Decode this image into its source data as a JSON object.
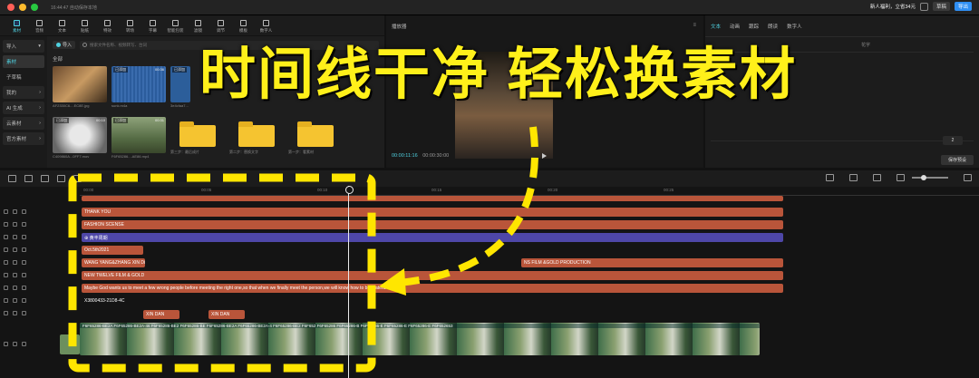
{
  "titlebar": {
    "time_status": "16:44:47 自动保存本地",
    "promo": "新人福利，立省34元",
    "share_label": "草稿",
    "export_label": "导出"
  },
  "toolbar": {
    "tools": [
      {
        "label": "素材",
        "icon": "media-icon",
        "active": true
      },
      {
        "label": "音频",
        "icon": "audio-icon"
      },
      {
        "label": "文本",
        "icon": "text-icon"
      },
      {
        "label": "贴纸",
        "icon": "sticker-icon"
      },
      {
        "label": "特效",
        "icon": "effects-icon"
      },
      {
        "label": "转场",
        "icon": "transition-icon"
      },
      {
        "label": "字幕",
        "icon": "caption-icon"
      },
      {
        "label": "智能包装",
        "icon": "smart-package-icon"
      },
      {
        "label": "滤镜",
        "icon": "filter-icon"
      },
      {
        "label": "调节",
        "icon": "adjust-icon"
      },
      {
        "label": "模板",
        "icon": "template-icon"
      },
      {
        "label": "数字人",
        "icon": "avatar-icon"
      }
    ]
  },
  "left_nav": {
    "items": [
      "导入",
      "素材",
      "子草稿",
      "我的",
      "AI 生成",
      "云素材",
      "官方素材"
    ]
  },
  "media": {
    "import_label": "导入",
    "search_placeholder": "搜索文件名称、视频转写、台词",
    "all_label": "全部",
    "items": [
      {
        "caption": "AF2330C6....EC8E.jpg",
        "tag": "",
        "duration": ""
      },
      {
        "caption": "sunk.m4a",
        "tag": "已添加",
        "duration": "00:36"
      },
      {
        "caption": "3e4cfaa7...",
        "tag": "已添加",
        "duration": ""
      },
      {
        "caption": "C409860A...0FF7.mov",
        "tag": "已添加",
        "duration": "00:10"
      },
      {
        "caption": "F6F65286....AE86.mp4",
        "tag": "已添加",
        "duration": "00:31"
      }
    ],
    "folders": [
      "第三步：最后成片",
      "第二步：替换文字",
      "第一步：看素材"
    ]
  },
  "player": {
    "title": "播放器",
    "current_time": "00:00:11:16",
    "total_time": "00:00:30:00"
  },
  "properties": {
    "tabs": [
      "文本",
      "动画",
      "跟踪",
      "朗读",
      "数字人"
    ],
    "font_label": "花字",
    "size_value": "2",
    "save_preset": "保存预设"
  },
  "headline": "时间线干净 轻松换素材",
  "timeline": {
    "ruler": [
      "00:00",
      "00:05",
      "00:10",
      "00:15",
      "00:20",
      "00:25"
    ],
    "clips": [
      {
        "text": "THANK YOU",
        "row": 0
      },
      {
        "text": "FASHION SCENSE",
        "row": 1
      },
      {
        "text": "黄丰周期",
        "row": 2
      },
      {
        "text": "Oct.5th2021",
        "row": 3
      },
      {
        "text": "WANG YANG&ZHANG XIN Di",
        "row": 4
      },
      {
        "text": "NS FILM &GOLD PRODUCTION",
        "row": 4
      },
      {
        "text": "NEW TWELVE FILM & GOLD",
        "row": 5
      },
      {
        "text": "Maybe God wants us to meet a few wrong people before meeting the right one,so that when we finally meet the person,we will know how to be grateful",
        "row": 6
      },
      {
        "text": "X3800433-21D8-4C",
        "row": 7
      },
      {
        "text": "XIN DAN",
        "row": 8
      },
      {
        "text": "XIN DAN",
        "row": 8
      }
    ],
    "video_strip": "F6F65286-BE2A  F6F65286-BE2A-46  F6F65286-BE2  F6F65286-BE  F6F65286-BE2A  F6F65286-BE2A-4  F6F65286-BE2  F6F652  F6F65286  F6F65286-B  F6F65286-E  F6F65286-E  F6F65286-E  F6F652653"
  },
  "colors": {
    "accent": "#4fd1e0",
    "clip": "#b9553a",
    "sticker_clip": "#4e47a8",
    "headline": "#fff01a",
    "annotation": "#ffe600"
  }
}
